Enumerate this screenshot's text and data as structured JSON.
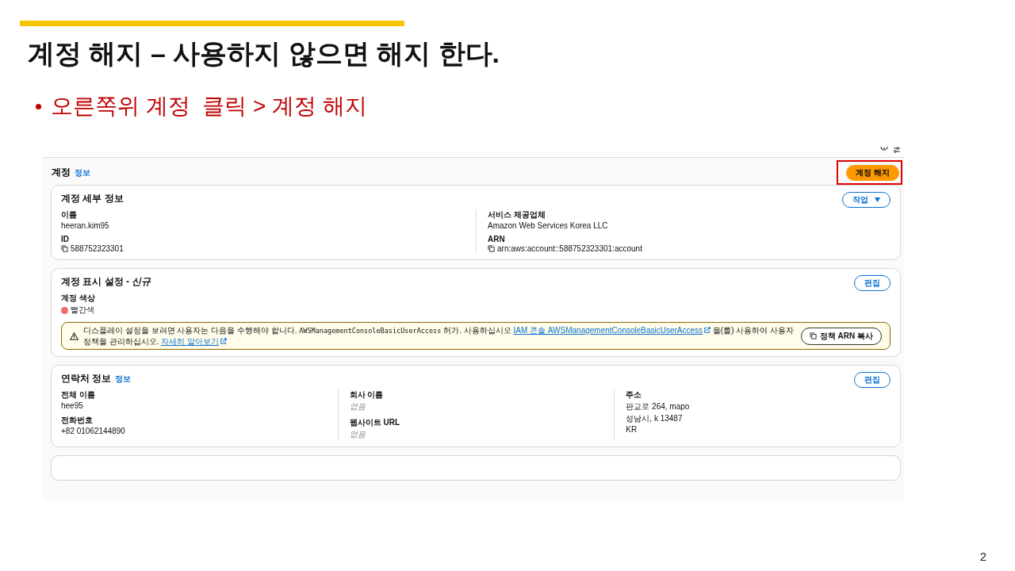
{
  "slide": {
    "title": "계정 해지 – 사용하지 않으면 해지 한다.",
    "bullet": "오른쪽위 계정  클릭 > 계정 해지",
    "page_number": "2"
  },
  "console": {
    "header": {
      "title": "계정",
      "info_link": "정보",
      "terminate_button": "계정 해지",
      "highlighted": true
    },
    "account_details": {
      "title": "계정 세부 정보",
      "action": "작업",
      "columns": [
        [
          {
            "label": "이름",
            "value": "heeran.kim95",
            "copy": false
          },
          {
            "label": "ID",
            "value": "588752323301",
            "copy": true
          }
        ],
        [
          {
            "label": "서비스 제공업체",
            "value": "Amazon Web Services Korea LLC",
            "copy": false
          },
          {
            "label": "ARN",
            "value": "arn:aws:account::588752323301:account",
            "copy": true
          }
        ]
      ]
    },
    "display_settings": {
      "title": "계정 표시 설정 - *신규*",
      "action": "편집",
      "color_label": "계정 색상",
      "color": {
        "name": "빨간색",
        "color": "#f06b6b"
      },
      "alert": {
        "parts": [
          {
            "kind": "text",
            "text": "디스플레이 설정을 보려면 사용자는 다음을 수행해야 합니다. "
          },
          {
            "kind": "code",
            "text": "AWSManagementConsoleBasicUserAccess"
          },
          {
            "kind": "text",
            "text": " 허가. 사용하십시오 "
          },
          {
            "kind": "link",
            "text": "IAM 콘솔 AWSManagementConsoleBasicUserAccess"
          },
          {
            "kind": "text",
            "text": " 을(를) 사용하여 사용자 정책을 관리하십시오. "
          },
          {
            "kind": "link",
            "text": "자세히 알아보기"
          }
        ],
        "button": "정책 ARN 복사"
      }
    },
    "contact_info": {
      "title": "연락처 정보",
      "info_link": "정보",
      "action": "편집",
      "columns": [
        [
          {
            "label": "전체 이름",
            "lines": [
              "hee95"
            ],
            "empty": false
          },
          {
            "label": "전화번호",
            "lines": [
              "+82 01062144890"
            ],
            "empty": false
          }
        ],
        [
          {
            "label": "회사 이름",
            "lines": [
              "없음"
            ],
            "empty": true
          },
          {
            "label": "웹사이트 URL",
            "lines": [
              "없음"
            ],
            "empty": true
          }
        ],
        [
          {
            "label": "주소",
            "lines": [
              "판교로 264, mapo",
              "성남시, k 13487",
              "KR"
            ],
            "empty": false
          }
        ]
      ]
    }
  }
}
